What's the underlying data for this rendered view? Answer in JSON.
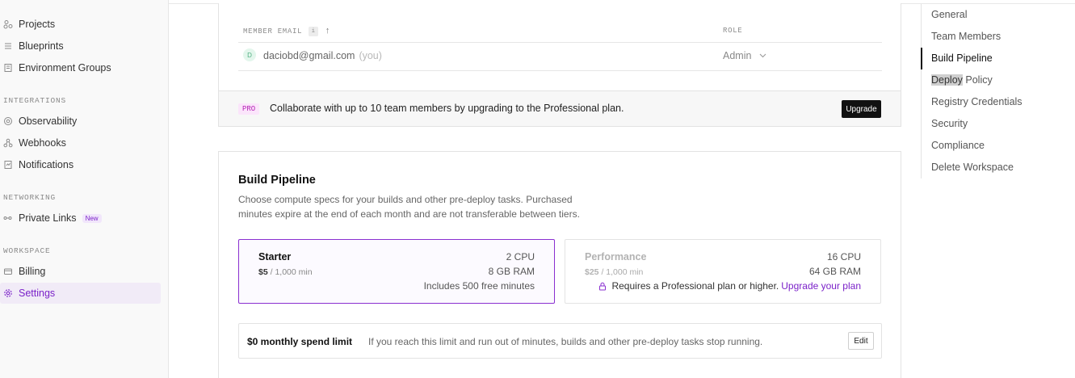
{
  "sidebar": {
    "items_top": [
      {
        "label": "Projects",
        "icon": "projects-icon"
      },
      {
        "label": "Blueprints",
        "icon": "blueprints-icon"
      },
      {
        "label": "Environment Groups",
        "icon": "environment-groups-icon"
      }
    ],
    "sections": {
      "integrations": "INTEGRATIONS",
      "networking": "NETWORKING",
      "workspace": "WORKSPACE"
    },
    "integrations": [
      {
        "label": "Observability",
        "icon": "observability-icon"
      },
      {
        "label": "Webhooks",
        "icon": "webhooks-icon"
      },
      {
        "label": "Notifications",
        "icon": "notifications-icon"
      }
    ],
    "networking": [
      {
        "label": "Private Links",
        "icon": "private-links-icon",
        "badge": "New"
      }
    ],
    "workspace": [
      {
        "label": "Billing",
        "icon": "billing-icon"
      },
      {
        "label": "Settings",
        "icon": "settings-icon",
        "active": true
      }
    ],
    "accent_color": "#7b22c9"
  },
  "team": {
    "columns": {
      "email": "MEMBER EMAIL",
      "info": "i",
      "role": "ROLE"
    },
    "member": {
      "avatar_initial": "D",
      "email": "daciobd@gmail.com",
      "you_tag": "(you)",
      "role": "Admin"
    },
    "pro_badge": "PRO",
    "upgrade_message": "Collaborate with up to 10 team members by upgrading to the Professional plan.",
    "upgrade_button": "Upgrade"
  },
  "build": {
    "title": "Build Pipeline",
    "description": "Choose compute specs for your builds and other pre-deploy tasks. Purchased minutes expire at the end of each month and are not transferable between tiers.",
    "tiers": [
      {
        "name": "Starter",
        "price": "$5",
        "per": "/ 1,000 min",
        "cpu": "2 CPU",
        "ram": "8 GB RAM",
        "note": "Includes 500 free minutes",
        "selected": true
      },
      {
        "name": "Performance",
        "price": "$25",
        "per": "/ 1,000 min",
        "cpu": "16 CPU",
        "ram": "64 GB RAM",
        "requirement": "Requires a Professional plan or higher.",
        "upgrade_link": "Upgrade your plan",
        "selected": false
      }
    ],
    "spend": {
      "label": "$0 monthly spend limit",
      "description": "If you reach this limit and run out of minutes, builds and other pre-deploy tasks stop running.",
      "edit_button": "Edit"
    }
  },
  "toc": {
    "items": [
      "General",
      "Team Members",
      "Build Pipeline",
      "Deploy",
      " Policy",
      "Registry Credentials",
      "Security",
      "Compliance",
      "Delete Workspace"
    ],
    "active": "Build Pipeline"
  }
}
